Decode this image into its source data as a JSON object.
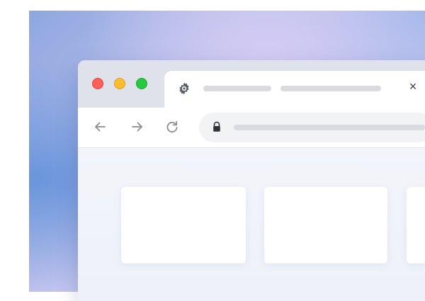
{
  "window": {
    "controls": [
      {
        "name": "close",
        "color": "#ff5f57",
        "border": "#e0443e"
      },
      {
        "name": "minimize",
        "color": "#febc2e",
        "border": "#d8a21e"
      },
      {
        "name": "zoom",
        "color": "#28c840",
        "border": "#1aab29"
      }
    ]
  },
  "tab": {
    "favicon_icon": "gear-icon",
    "close_label": "×"
  },
  "toolbar": {
    "back_icon": "arrow-left-icon",
    "forward_icon": "arrow-right-icon",
    "reload_icon": "reload-icon",
    "security_icon": "lock-icon"
  },
  "content": {
    "card_count_visible": 3
  }
}
